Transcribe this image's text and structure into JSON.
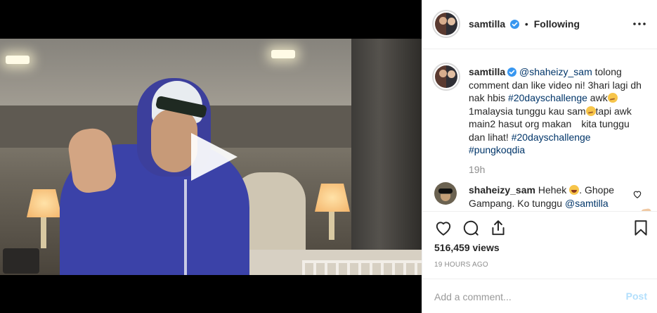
{
  "post": {
    "author": "samtilla",
    "follow_status": "Following",
    "dot": "•",
    "more_icon": "more-horizontal-icon"
  },
  "caption": {
    "username": "samtilla",
    "mention": "@shaheizy_sam",
    "text1": " tolong comment dan like video ni! 3hari lagi dh nak hbis ",
    "hashtag1": "#20dayschallenge",
    "text2": " awk",
    "text3": " 1malaysia tunggu kau sam",
    "text4": "tapi awk main2 hasut org makan",
    "text5": "kita tunggu dan lihat! ",
    "hashtag2": "#20dayschallenge",
    "hashtag3": "#pungkoqdia",
    "time": "19h"
  },
  "reply": {
    "username": "shaheizy_sam",
    "text1": " Hehek ",
    "text2": ". Ghope Gampang. Ko tunggu ",
    "mention": "@samtilla"
  },
  "stats": {
    "views": "516,459 views",
    "timestamp": "19 HOURS AGO"
  },
  "comment": {
    "placeholder": "Add a comment...",
    "post_label": "Post"
  },
  "colors": {
    "link": "#003569",
    "verified": "#3897f0",
    "post_disabled": "#b2dffc",
    "muted": "#8e8e8e"
  }
}
